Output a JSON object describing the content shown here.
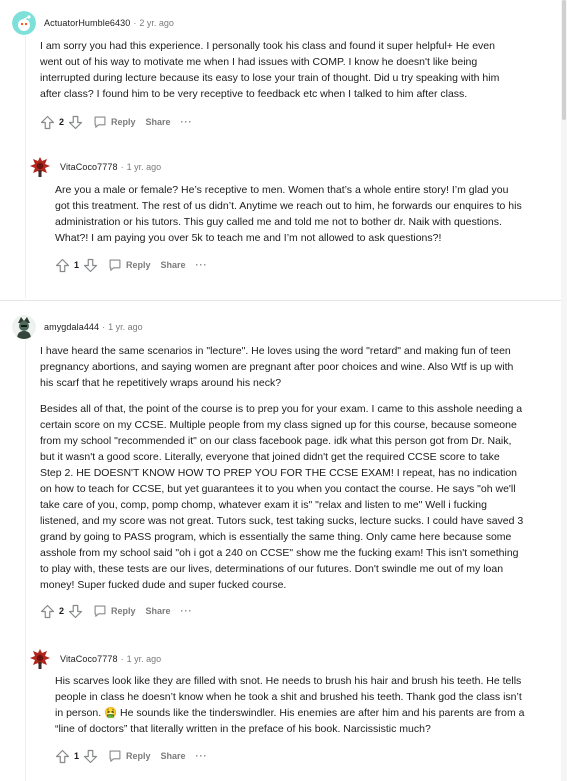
{
  "colors": {
    "text": "#1c1c1c",
    "meta": "#7c7c7c",
    "rail": "#edeff1",
    "action": "#878a8c"
  },
  "comments": [
    {
      "username": "ActuatorHumble6430",
      "separator": "·",
      "age": "2 yr. ago",
      "avatar_icon": "teal-snoo-avatar-icon",
      "paragraphs": [
        "I am sorry you had this experience. I personally took his class and found it super helpful+ He even went out of his way to motivate me when I had issues with COMP. I know he doesn't like being interrupted during lecture because its easy to lose your train of thought. Did u try speaking with him after class? I found him to be very receptive to feedback etc when I talked to him after class."
      ],
      "score": "2",
      "reply_label": "Reply",
      "share_label": "Share",
      "more_label": "···"
    },
    {
      "username": "VitaCoco7778",
      "separator": "·",
      "age": "1 yr. ago",
      "avatar_icon": "red-creature-avatar-icon",
      "paragraphs": [
        "Are you a male or female? He’s receptive to men. Women that’s a whole entire story! I’m glad you got this treatment. The rest of us didn’t. Anytime we reach out to him, he forwards our enquires to his administration or his tutors. This guy called me and told me not to bother dr. Naik with questions. What?! I am paying you over 5k to teach me and I’m not allowed to ask questions?!"
      ],
      "score": "1",
      "reply_label": "Reply",
      "share_label": "Share",
      "more_label": "···"
    },
    {
      "username": "amygdala444",
      "separator": "·",
      "age": "1 yr. ago",
      "avatar_icon": "dark-character-avatar-icon",
      "paragraphs": [
        "I have heard the same scenarios in \"lecture\". He loves using the word \"retard\" and making fun of teen pregnancy abortions, and saying women are pregnant after poor choices and wine. Also Wtf is up with his scarf that he repetitively wraps around his neck?",
        "Besides all of that, the point of the course is to prep you for your exam. I came to this asshole needing a certain score on my CCSE. Multiple people from my class signed up for this course, because someone from my school \"recommended it\" on our class facebook page. idk what this person got from Dr. Naik, but it wasn't a good score. Literally, everyone that joined didn't get the required CCSE score to take Step 2. HE DOESN'T KNOW HOW TO PREP YOU FOR THE CCSE EXAM! I repeat, has no indication on how to teach for CCSE, but yet guarantees it to you when you contact the course. He says \"oh we'll take care of you, comp, pomp chomp, whatever exam it is\" \"relax and listen to me\" Well i fucking listened, and my score was not great. Tutors suck, test taking sucks, lecture sucks. I could have saved 3 grand by going to PASS program, which is essentially the same thing. Only came here because some asshole from my school said \"oh i got a 240 on CCSE\" show me the fucking exam! This isn't something to play with, these tests are our lives, determinations of our futures. Don't swindle me out of my loan money! Super fucked dude and super fucked course."
      ],
      "score": "2",
      "reply_label": "Reply",
      "share_label": "Share",
      "more_label": "···"
    },
    {
      "username": "VitaCoco7778",
      "separator": "·",
      "age": "1 yr. ago",
      "avatar_icon": "red-creature-avatar-icon",
      "paragraphs_a": "His scarves look like they are filled with snot. He needs to brush his hair and brush his teeth. He tells people in class he doesn’t know when he took a shit and brushed his teeth. Thank god the class isn’t in person.",
      "emoji": "🤮",
      "emoji_icon": "vomiting-face-emoji-icon",
      "paragraphs_b": "He sounds like the tinderswindler. His enemies are after him and his parents are from a “line of doctors” that literally written in the preface of his book. Narcissistic much?",
      "score": "1",
      "reply_label": "Reply",
      "share_label": "Share",
      "more_label": "···"
    }
  ]
}
